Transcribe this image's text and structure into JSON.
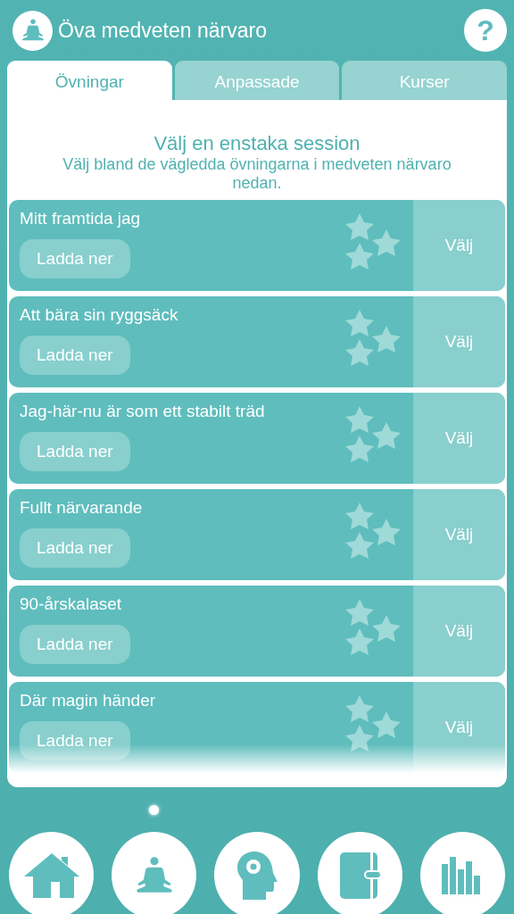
{
  "header": {
    "title": "Öva medveten närvaro",
    "help": "?"
  },
  "tabs": [
    {
      "label": "Övningar",
      "selected": true
    },
    {
      "label": "Anpassade",
      "selected": false
    },
    {
      "label": "Kurser",
      "selected": false
    }
  ],
  "intro": {
    "heading": "Välj en enstaka session",
    "text": "Välj bland de vägledda övningarna i medveten närvaro nedan."
  },
  "sessions": [
    {
      "title": "Mitt framtida jag",
      "download": "Ladda ner",
      "choose": "Välj"
    },
    {
      "title": "Att bära sin ryggsäck",
      "download": "Ladda ner",
      "choose": "Välj"
    },
    {
      "title": "Jag-här-nu är som ett stabilt träd",
      "download": "Ladda ner",
      "choose": "Välj"
    },
    {
      "title": "Fullt närvarande",
      "download": "Ladda ner",
      "choose": "Välj"
    },
    {
      "title": "90-årskalaset",
      "download": "Ladda ner",
      "choose": "Välj"
    },
    {
      "title": "Där magin händer",
      "download": "Ladda ner",
      "choose": "Välj"
    }
  ],
  "nav": [
    {
      "kind": "home",
      "selected": false
    },
    {
      "kind": "meditation",
      "selected": true
    },
    {
      "kind": "mind",
      "selected": false
    },
    {
      "kind": "journal",
      "selected": false
    },
    {
      "kind": "stats",
      "selected": false
    }
  ]
}
